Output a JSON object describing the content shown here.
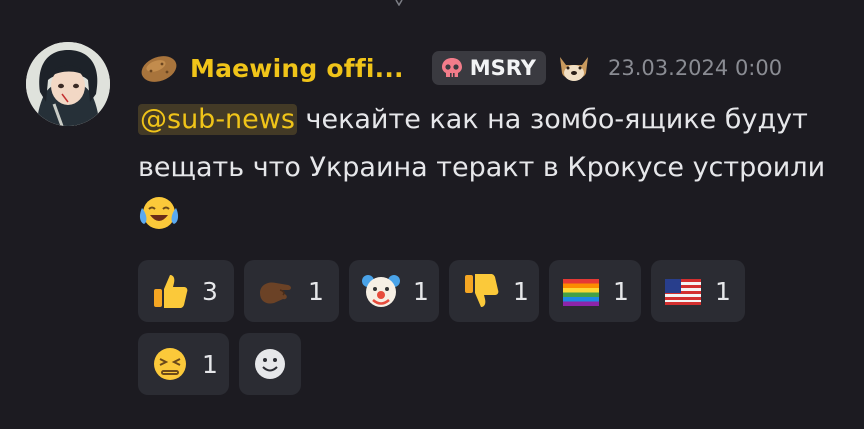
{
  "message": {
    "author": {
      "name": "Maewing offi...",
      "tag": "MSRY",
      "timestamp": "23.03.2024 0:00"
    },
    "mention": "@sub-news",
    "text": " чекайте как на зомбо-ящике будут вещать что Украина теракт в Крокусе устроили"
  },
  "reactions": [
    {
      "emoji": "thumbs-up",
      "count": "3"
    },
    {
      "emoji": "pinching-hand",
      "count": "1"
    },
    {
      "emoji": "clown-face",
      "count": "1"
    },
    {
      "emoji": "thumbs-down",
      "count": "1"
    },
    {
      "emoji": "rainbow-flag",
      "count": "1"
    },
    {
      "emoji": "us-flag",
      "count": "1"
    },
    {
      "emoji": "persevering-face",
      "count": "1"
    }
  ],
  "colors": {
    "background": "#1c1b21",
    "username": "#f0c419",
    "mention_bg": "#433a26",
    "reaction_bg": "#2b2c33",
    "timestamp": "#8a8c93"
  }
}
